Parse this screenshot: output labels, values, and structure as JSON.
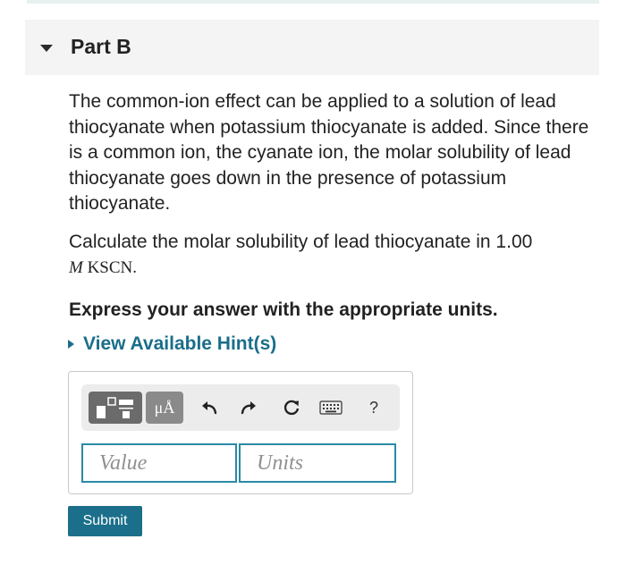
{
  "part": {
    "title": "Part B"
  },
  "question": {
    "paragraph1": "The common-ion effect can be applied to a solution of lead thiocyanate when potassium thiocyanate is added. Since there is a common ion, the cyanate ion, the molar solubility of lead thiocyanate goes down in the presence of potassium thiocyanate.",
    "paragraph2_text": "Calculate the molar solubility of lead thiocyanate in 1.00",
    "paragraph2_unit_symbol": "M",
    "paragraph2_formula": "KSCN",
    "paragraph2_end": ".",
    "express": "Express your answer with the appropriate units.",
    "hint_link": "View Available Hint(s)"
  },
  "toolbar": {
    "units_label": "μÅ",
    "help_label": "?",
    "icons": [
      "templates-icon",
      "units-icon",
      "undo-icon",
      "redo-icon",
      "reset-icon",
      "keyboard-icon",
      "help-icon"
    ]
  },
  "answer": {
    "value_placeholder": "Value",
    "units_placeholder": "Units"
  },
  "submit_label": "Submit",
  "colors": {
    "accent": "#1b6f8a",
    "field_border": "#2a8aa6",
    "link": "#1a6e8a",
    "header_bg": "#f4f4f4"
  }
}
